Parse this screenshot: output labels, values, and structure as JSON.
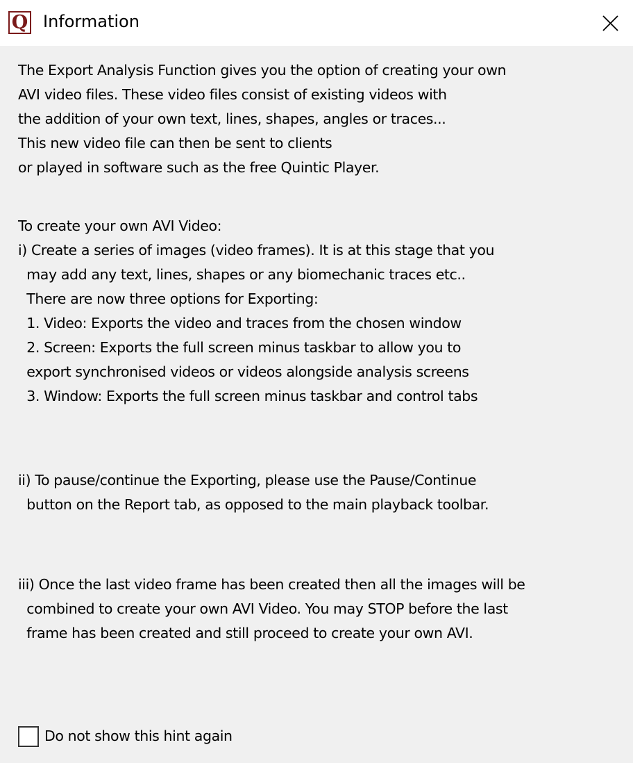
{
  "window": {
    "title": "Information",
    "app_icon_letter": "Q"
  },
  "message": {
    "intro": "The Export Analysis Function gives you the option of creating your own\nAVI video files. These video files consist of existing videos with\nthe addition of your own text, lines, shapes, angles or traces...\nThis new video file can then be sent to clients\nor played in software such as the free Quintic Player.",
    "create_steps": "To create your own AVI Video:\ni) Create a series of images (video frames). It is at this stage that you\n  may add any text, lines, shapes or any biomechanic traces etc..\n  There are now three options for Exporting:\n  1. Video: Exports the video and traces from the chosen window\n  2. Screen: Exports the full screen minus taskbar to allow you to\n  export synchronised videos or videos alongside analysis screens\n  3. Window: Exports the full screen minus taskbar and control tabs",
    "pause_step": "ii) To pause/continue the Exporting, please use the Pause/Continue\n  button on the Report tab, as opposed to the main playback toolbar.",
    "final_step": "iii) Once the last video frame has been created then all the images will be\n  combined to create your own AVI Video. You may STOP before the last\n  frame has been created and still proceed to create your own AVI."
  },
  "hint_checkbox": {
    "label": "Do not show this hint again",
    "checked": false
  },
  "icons": {
    "app": "quintic-q-icon",
    "close": "close-icon"
  },
  "colors": {
    "app_icon": "#7a1a1a",
    "background": "#f0f0f0",
    "titlebar": "#ffffff"
  }
}
